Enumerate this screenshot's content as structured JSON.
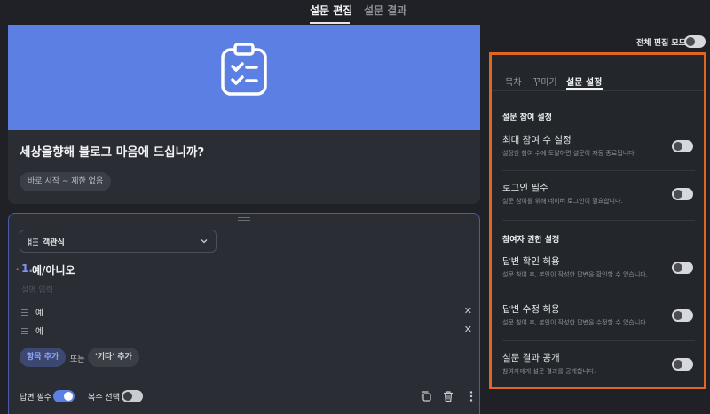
{
  "top_tabs": {
    "edit": "설문 편집",
    "results": "설문 결과"
  },
  "survey": {
    "title": "세상을향해 블로그 마음에 드십니까?",
    "period_chip": "바로 시작 ~ 제한 없음"
  },
  "question": {
    "type_label": "객관식",
    "number": "1.",
    "title": "예/아니오",
    "description_placeholder": "설명 입력",
    "options": [
      "예",
      "예"
    ],
    "add_item_label": "항목 추가",
    "or_label": "또는",
    "add_other_label": "'기타' 추가",
    "required_label": "답변 필수",
    "required_on": true,
    "multiple_label": "복수 선택",
    "multiple_on": false
  },
  "full_edit_mode": {
    "label": "전체 편집 모드",
    "on": false
  },
  "settings": {
    "tabs": [
      "목차",
      "꾸미기",
      "설문 설정"
    ],
    "active_tab": "설문 설정",
    "sections": [
      {
        "title": "설문 참여 설정",
        "items": [
          {
            "title": "최대 참여 수 설정",
            "desc": "설정한 참여 수에 도달하면 설문이 자동 종료됩니다.",
            "on": false
          },
          {
            "title": "로그인 필수",
            "desc": "설문 참여를 위해 네이버 로그인이 필요합니다.",
            "on": false
          }
        ]
      },
      {
        "title": "참여자 권한 설정",
        "items": [
          {
            "title": "답변 확인 허용",
            "desc": "설문 참여 후, 본인이 작성한 답변을 확인할 수 있습니다.",
            "on": false
          },
          {
            "title": "답변 수정 허용",
            "desc": "설문 참여 후, 본인이 작성한 답변을 수정할 수 있습니다.",
            "on": false
          },
          {
            "title": "설문 결과 공개",
            "desc": "참여자에게 설문 결과를 공개합니다.",
            "on": false
          }
        ]
      }
    ]
  },
  "colors": {
    "accent": "#5c7fe3",
    "highlight_border": "#e0671f",
    "background": "#1f2126",
    "card": "#2a2d33"
  }
}
